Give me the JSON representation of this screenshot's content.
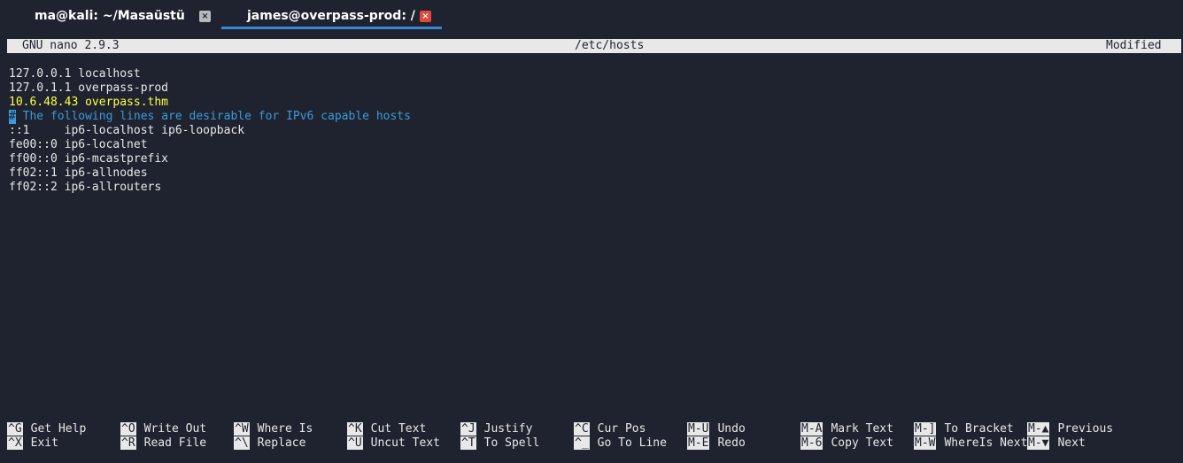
{
  "tabs": [
    {
      "title": "ma@kali: ~/Masaüstü",
      "close": "×"
    },
    {
      "title": "james@overpass-prod: /",
      "close": "×"
    }
  ],
  "titlebar": {
    "version": "GNU nano 2.9.3",
    "filename": "/etc/hosts",
    "status": "Modified"
  },
  "editor": {
    "lines": [
      "127.0.0.1 localhost",
      "127.0.1.1 overpass-prod",
      "10.6.48.43 overpass.thm",
      "# The following lines are desirable for IPv6 capable hosts",
      "::1     ip6-localhost ip6-loopback",
      "fe00::0 ip6-localnet",
      "ff00::0 ip6-mcastprefix",
      "ff02::1 ip6-allnodes",
      "ff02::2 ip6-allrouters"
    ],
    "comment_marker": "#",
    "comment_rest": " The following lines are desirable for IPv6 capable hosts"
  },
  "shortcuts": [
    {
      "key": "^G",
      "label": "Get Help"
    },
    {
      "key": "^X",
      "label": "Exit"
    },
    {
      "key": "^O",
      "label": "Write Out"
    },
    {
      "key": "^R",
      "label": "Read File"
    },
    {
      "key": "^W",
      "label": "Where Is"
    },
    {
      "key": "^\\",
      "label": "Replace"
    },
    {
      "key": "^K",
      "label": "Cut Text"
    },
    {
      "key": "^U",
      "label": "Uncut Text"
    },
    {
      "key": "^J",
      "label": "Justify"
    },
    {
      "key": "^T",
      "label": "To Spell"
    },
    {
      "key": "^C",
      "label": "Cur Pos"
    },
    {
      "key": "^_",
      "label": "Go To Line"
    },
    {
      "key": "M-U",
      "label": "Undo"
    },
    {
      "key": "M-E",
      "label": "Redo"
    },
    {
      "key": "M-A",
      "label": "Mark Text"
    },
    {
      "key": "M-6",
      "label": "Copy Text"
    },
    {
      "key": "M-]",
      "label": "To Bracket"
    },
    {
      "key": "M-W",
      "label": "WhereIs Next"
    },
    {
      "key": "M-▲",
      "label": "Previous"
    },
    {
      "key": "M-▼",
      "label": "Next"
    }
  ],
  "colors": {
    "background": "#1f2330",
    "active_tab_underline": "#3a87d6",
    "close_active": "#e0483a",
    "comment": "#3a9ad9",
    "highlight_text": "#ffff40"
  }
}
